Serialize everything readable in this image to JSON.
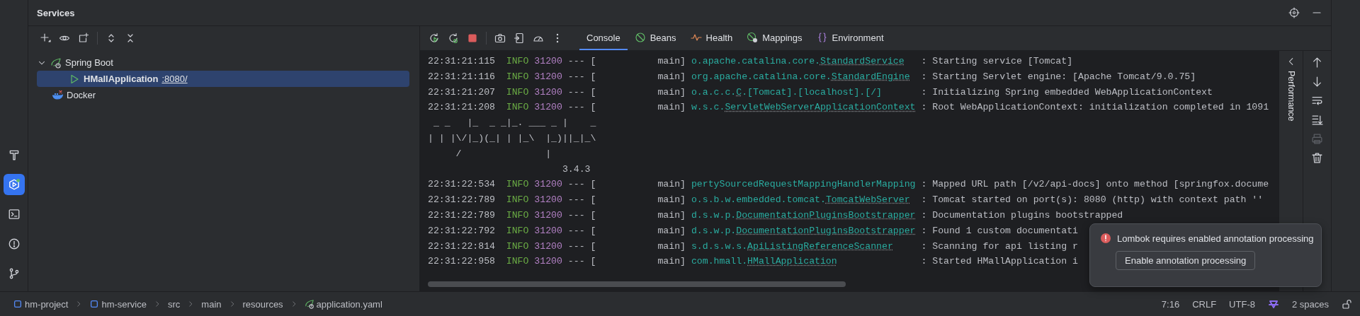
{
  "tool_stripe": [
    {
      "kind": "build",
      "selected": false
    },
    {
      "kind": "services",
      "selected": true
    },
    {
      "kind": "terminal",
      "selected": false
    },
    {
      "kind": "problems",
      "selected": false
    },
    {
      "kind": "git",
      "selected": false
    }
  ],
  "services": {
    "title": "Services",
    "toolbar": [
      {
        "kind": "add"
      },
      {
        "kind": "view"
      },
      {
        "kind": "new-tab"
      },
      {
        "kind": "expand-all"
      },
      {
        "kind": "collapse-all"
      }
    ],
    "tree": [
      {
        "label": "Spring Boot",
        "kind": "spring",
        "expanded": true,
        "selected": false,
        "children": [
          {
            "label": "HMallApplication",
            "kind": "run",
            "port": ":8080/",
            "selected": true
          }
        ]
      },
      {
        "label": "Docker",
        "kind": "docker",
        "selected": false
      }
    ]
  },
  "console": {
    "toolbar": [
      {
        "kind": "rerun"
      },
      {
        "kind": "rerun-debug"
      },
      {
        "kind": "stop"
      },
      {
        "kind": "screenshot"
      },
      {
        "kind": "export"
      },
      {
        "kind": "gauge"
      },
      {
        "kind": "more"
      }
    ],
    "tabs": [
      {
        "label": "Console",
        "kind": "console",
        "selected": true
      },
      {
        "label": "Beans",
        "kind": "beans",
        "selected": false
      },
      {
        "label": "Health",
        "kind": "health",
        "selected": false
      },
      {
        "label": "Mappings",
        "kind": "mappings",
        "selected": false
      },
      {
        "label": "Environment",
        "kind": "environment",
        "selected": false
      }
    ],
    "lines": [
      {
        "kind": "log",
        "time": "22:31:21:115",
        "level": "INFO",
        "pid": "31200",
        "thread": "--- [           main]",
        "logger": [
          {
            "text": "o.apache.catalina.core.",
            "link": false
          },
          {
            "text": "StandardService",
            "link": true
          }
        ],
        "message": ": Starting service [Tomcat]"
      },
      {
        "kind": "log",
        "time": "22:31:21:116",
        "level": "INFO",
        "pid": "31200",
        "thread": "--- [           main]",
        "logger": [
          {
            "text": "org.apache.catalina.core.",
            "link": false
          },
          {
            "text": "StandardEngine",
            "link": true
          }
        ],
        "message": ": Starting Servlet engine: [Apache Tomcat/9.0.75]"
      },
      {
        "kind": "log",
        "time": "22:31:21:207",
        "level": "INFO",
        "pid": "31200",
        "thread": "--- [           main]",
        "logger": [
          {
            "text": "o.a.c.c.",
            "link": false
          },
          {
            "text": "C",
            "link": true
          },
          {
            "text": ".[Tomcat].[localhost].[/]",
            "link": false
          }
        ],
        "message": ": Initializing Spring embedded WebApplicationContext"
      },
      {
        "kind": "log",
        "time": "22:31:21:208",
        "level": "INFO",
        "pid": "31200",
        "thread": "--- [           main]",
        "logger": [
          {
            "text": "w.s.c.",
            "link": false
          },
          {
            "text": "ServletWebServerApplicationContext",
            "link": true
          }
        ],
        "message": ": Root WebApplicationContext: initialization completed in 1091"
      },
      {
        "kind": "banner",
        "text": " _ _   |_  _ _|_. ___ _ |    _"
      },
      {
        "kind": "banner",
        "text": "| | |\\/|_)(_| | |_\\  |_)||_|_\\"
      },
      {
        "kind": "banner",
        "text": "     /               |"
      },
      {
        "kind": "banner",
        "text": "                        3.4.3"
      },
      {
        "kind": "log",
        "time": "22:31:22:534",
        "level": "INFO",
        "pid": "31200",
        "thread": "--- [           main]",
        "logger": [
          {
            "text": "pertySourcedRequestMappingHandlerMapping",
            "link": false
          }
        ],
        "message": ": Mapped URL path [/v2/api-docs] onto method [springfox.docume"
      },
      {
        "kind": "log",
        "time": "22:31:22:789",
        "level": "INFO",
        "pid": "31200",
        "thread": "--- [           main]",
        "logger": [
          {
            "text": "o.s.b.w.embedded.tomcat.",
            "link": false
          },
          {
            "text": "TomcatWebServer",
            "link": true
          }
        ],
        "message": ": Tomcat started on port(s): 8080 (http) with context path ''"
      },
      {
        "kind": "log",
        "time": "22:31:22:789",
        "level": "INFO",
        "pid": "31200",
        "thread": "--- [           main]",
        "logger": [
          {
            "text": "d.s.w.p.",
            "link": false
          },
          {
            "text": "DocumentationPluginsBootstrapper",
            "link": true
          }
        ],
        "message": ": Documentation plugins bootstrapped"
      },
      {
        "kind": "log",
        "time": "22:31:22:792",
        "level": "INFO",
        "pid": "31200",
        "thread": "--- [           main]",
        "logger": [
          {
            "text": "d.s.w.p.",
            "link": false
          },
          {
            "text": "DocumentationPluginsBootstrapper",
            "link": true
          }
        ],
        "message": ": Found 1 custom documentati"
      },
      {
        "kind": "log",
        "time": "22:31:22:814",
        "level": "INFO",
        "pid": "31200",
        "thread": "--- [           main]",
        "logger": [
          {
            "text": "s.d.s.w.s.",
            "link": false
          },
          {
            "text": "ApiListingReferenceScanner",
            "link": true
          }
        ],
        "message": ": Scanning for api listing r"
      },
      {
        "kind": "log",
        "time": "22:31:22:958",
        "level": "INFO",
        "pid": "31200",
        "thread": "--- [           main]",
        "logger": [
          {
            "text": "com.hmall.",
            "link": false
          },
          {
            "text": "HMallApplication",
            "link": true
          }
        ],
        "message": ": Started HMallApplication i"
      }
    ],
    "side_tab": "Performance",
    "actions": [
      {
        "kind": "up",
        "disabled": false
      },
      {
        "kind": "down",
        "disabled": false
      },
      {
        "kind": "wrap",
        "disabled": false
      },
      {
        "kind": "scroll-end",
        "disabled": false
      },
      {
        "kind": "print",
        "disabled": true
      },
      {
        "kind": "trash",
        "disabled": false
      }
    ]
  },
  "notification": {
    "message": "Lombok requires enabled annotation processing",
    "button": "Enable annotation processing"
  },
  "status_bar": {
    "breadcrumbs": [
      {
        "label": "hm-project",
        "kind": "module"
      },
      {
        "label": "hm-service",
        "kind": "module"
      },
      {
        "label": "src",
        "kind": "folder"
      },
      {
        "label": "main",
        "kind": "folder"
      },
      {
        "label": "resources",
        "kind": "folder"
      },
      {
        "label": "application.yaml",
        "kind": "spring-file"
      }
    ],
    "items": [
      {
        "kind": "text",
        "label": "7:16"
      },
      {
        "kind": "text",
        "label": "CRLF"
      },
      {
        "kind": "text",
        "label": "UTF-8"
      },
      {
        "kind": "assistant"
      },
      {
        "kind": "text",
        "label": "2 spaces"
      },
      {
        "kind": "lock"
      }
    ]
  }
}
